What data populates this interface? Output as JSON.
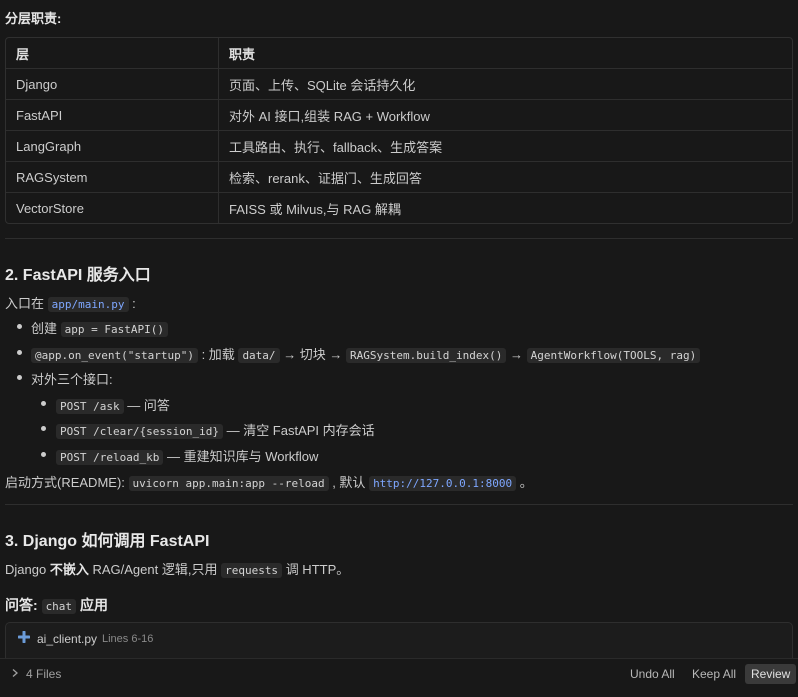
{
  "section_label": "分层职责:",
  "table": {
    "headers": [
      "层",
      "职责"
    ],
    "rows": [
      [
        "Django",
        "页面、上传、SQLite 会话持久化"
      ],
      [
        "FastAPI",
        "对外 AI 接口,组装 RAG + Workflow"
      ],
      [
        "LangGraph",
        "工具路由、执行、fallback、生成答案"
      ],
      [
        "RAGSystem",
        "检索、rerank、证据门、生成回答"
      ],
      [
        "VectorStore",
        "FAISS 或 Milvus,与 RAG 解耦"
      ]
    ]
  },
  "section2": {
    "heading": "2. FastAPI 服务入口",
    "entry_prefix": "入口在",
    "entry_file": "app/main.py",
    "entry_suffix": ":",
    "b1_text": "创建",
    "b1_code": "app = FastAPI()",
    "b2_code1": "@app.on_event(\"startup\")",
    "b2_text1": ": 加载",
    "b2_code2": "data/",
    "b2_text2": "→ 切块 →",
    "b2_code3": "RAGSystem.build_index()",
    "b2_text3": "→",
    "b2_code4": "AgentWorkflow(TOOLS, rag)",
    "b3_text": "对外三个接口:",
    "sub1_code": "POST /ask",
    "sub1_text": "— 问答",
    "sub2_code": "POST /clear/{session_id}",
    "sub2_text": "— 清空 FastAPI 内存会话",
    "sub3_code": "POST /reload_kb",
    "sub3_text": "— 重建知识库与 Workflow",
    "start_prefix": "启动方式(README):",
    "start_code": "uvicorn app.main:app --reload",
    "start_mid": ", 默认",
    "start_url": "http://127.0.0.1:8000",
    "start_suffix": "。"
  },
  "section3": {
    "heading": "3. Django 如何调用 FastAPI",
    "p_prefix": "Django",
    "p_bold": "不嵌入",
    "p_mid": "RAG/Agent 逻辑,只用",
    "p_code": "requests",
    "p_suffix": "调 HTTP。",
    "sub_prefix": "问答:",
    "sub_code": "chat",
    "sub_suffix": "应用"
  },
  "file_card": {
    "name": "ai_client.py",
    "lines": "Lines 6-16",
    "icon": "python-file-icon",
    "icon_color": "#6b9bd8"
  },
  "bottom_bar": {
    "files": "4 Files",
    "undo_all": "Undo All",
    "keep_all": "Keep All",
    "review": "Review"
  }
}
